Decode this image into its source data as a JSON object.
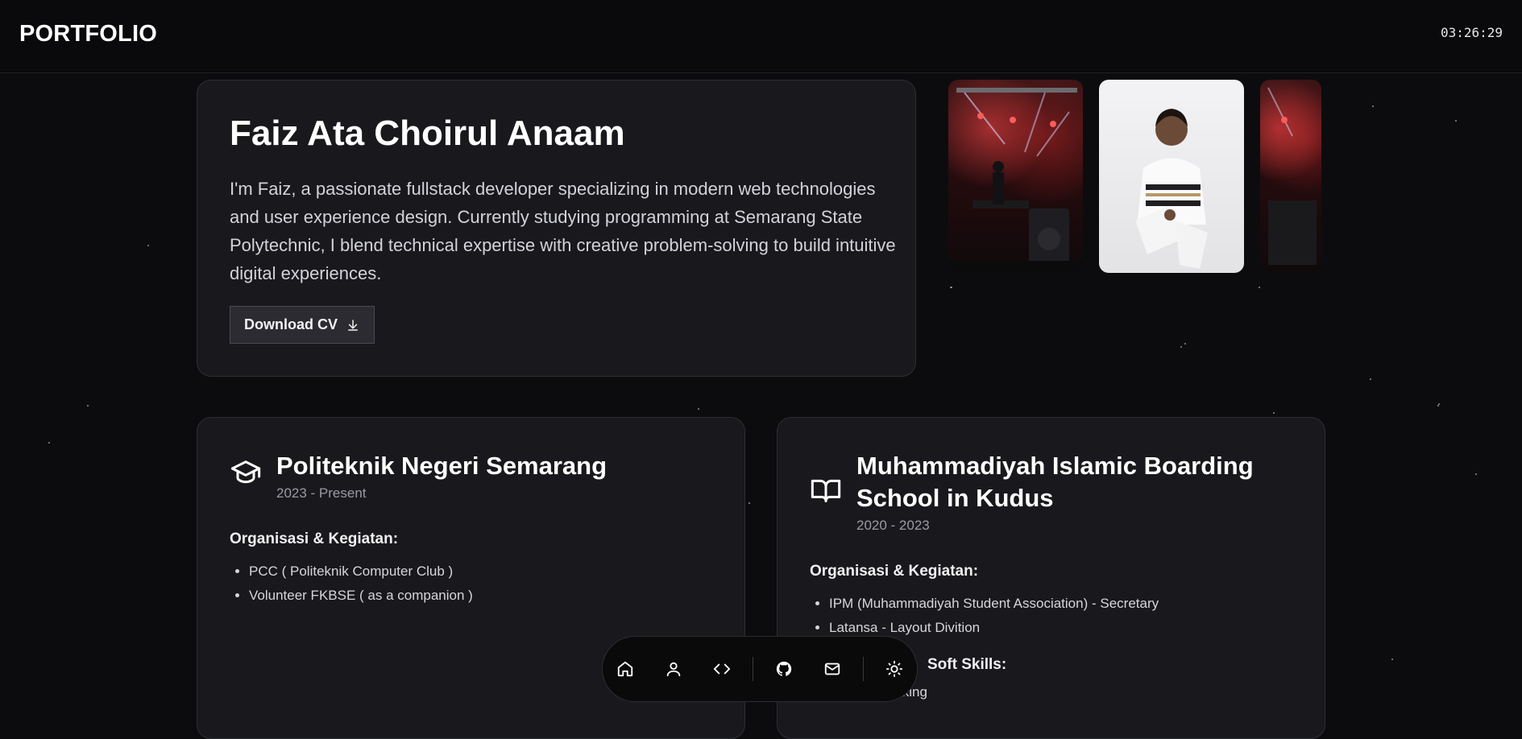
{
  "header": {
    "brand": "PORTFOLIO",
    "clock": "03:26:29"
  },
  "hero": {
    "name": "Faiz Ata Choirul Anaam",
    "bio": "I'm Faiz, a passionate fullstack developer specializing in modern web technologies and user experience design. Currently studying programming at Semarang State Polytechnic, I blend technical expertise with creative problem-solving to build intuitive digital experiences.",
    "cv_button": "Download CV"
  },
  "education": [
    {
      "icon": "graduation-cap-icon",
      "school": "Politeknik Negeri Semarang",
      "years": "2023 - Present",
      "activities_label": "Organisasi & Kegiatan:",
      "activities": [
        "PCC ( Politeknik Computer Club )",
        "Volunteer FKBSE ( as a companion )"
      ]
    },
    {
      "icon": "book-open-icon",
      "school": "Muhammadiyah Islamic Boarding School in Kudus",
      "years": "2020 - 2023",
      "activities_label": "Organisasi & Kegiatan:",
      "activities": [
        "IPM (Muhammadiyah Student Association) - Secretary",
        "Latansa - Layout Divition"
      ],
      "soft_skills_label": "Soft Skills:",
      "soft_skills": [
        "Public Speaking"
      ]
    }
  ],
  "dock": {
    "items": [
      "home-icon",
      "user-icon",
      "code-icon",
      "github-icon",
      "mail-icon",
      "sun-icon"
    ]
  },
  "colors": {
    "background": "#0c0c0f",
    "card": "#19191d",
    "accent_text": "#ffffff"
  }
}
